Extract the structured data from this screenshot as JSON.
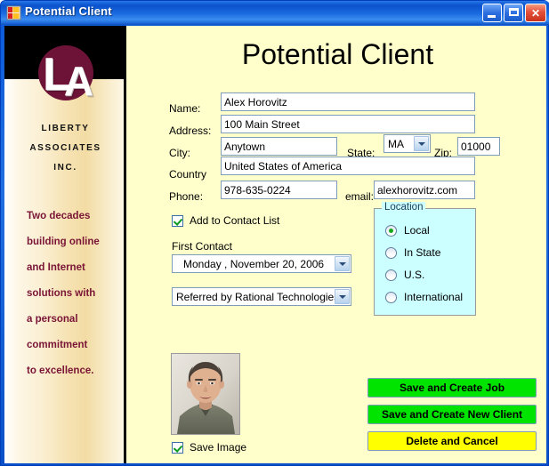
{
  "window": {
    "title": "Potential Client",
    "icon": "vb-form-icon",
    "controls": {
      "minimize": "Minimize",
      "maximize": "Maximize",
      "close": "Close"
    }
  },
  "sidebar": {
    "logo_letters": "LA",
    "company_lines": [
      "LIBERTY",
      "ASSOCIATES",
      "INC."
    ],
    "tagline_lines": [
      "Two decades",
      "building online",
      "and Internet",
      "solutions with",
      "a personal",
      "commitment",
      "to excellence."
    ],
    "tagline_color": "#7a1436",
    "logo_color": "#6e1338"
  },
  "form": {
    "title": "Potential Client",
    "fields": {
      "name": {
        "label": "Name:",
        "value": "Alex Horovitz"
      },
      "address": {
        "label": "Address:",
        "value": "100 Main Street"
      },
      "city": {
        "label": "City:",
        "value": "Anytown"
      },
      "state": {
        "label": "State:",
        "value": "MA"
      },
      "zip": {
        "label": "Zip:",
        "value": "01000"
      },
      "country": {
        "label": "Country",
        "value": "United States of America"
      },
      "phone": {
        "label": "Phone:",
        "value": "978-635-0224"
      },
      "email": {
        "label": "email:",
        "value": "alexhorovitz.com"
      }
    },
    "add_to_contact_list": {
      "label": "Add to Contact List",
      "checked": true
    },
    "first_contact": {
      "label": "First Contact",
      "value": "Monday    , November 20, 2006"
    },
    "referral": {
      "value": "Referred by Rational Technologies"
    },
    "location": {
      "title": "Location",
      "background": "#ccffff",
      "options": [
        "Local",
        "In State",
        "U.S.",
        "International"
      ],
      "selected": "Local"
    },
    "save_image": {
      "label": "Save Image",
      "checked": true
    },
    "photo_alt": "client-portrait-photo",
    "buttons": [
      {
        "label": "Save and Create Job",
        "color": "#00e400",
        "style": "green"
      },
      {
        "label": "Save and Create New Client",
        "color": "#00e400",
        "style": "green"
      },
      {
        "label": "Delete and Cancel",
        "color": "#ffff00",
        "style": "yellow"
      }
    ]
  }
}
